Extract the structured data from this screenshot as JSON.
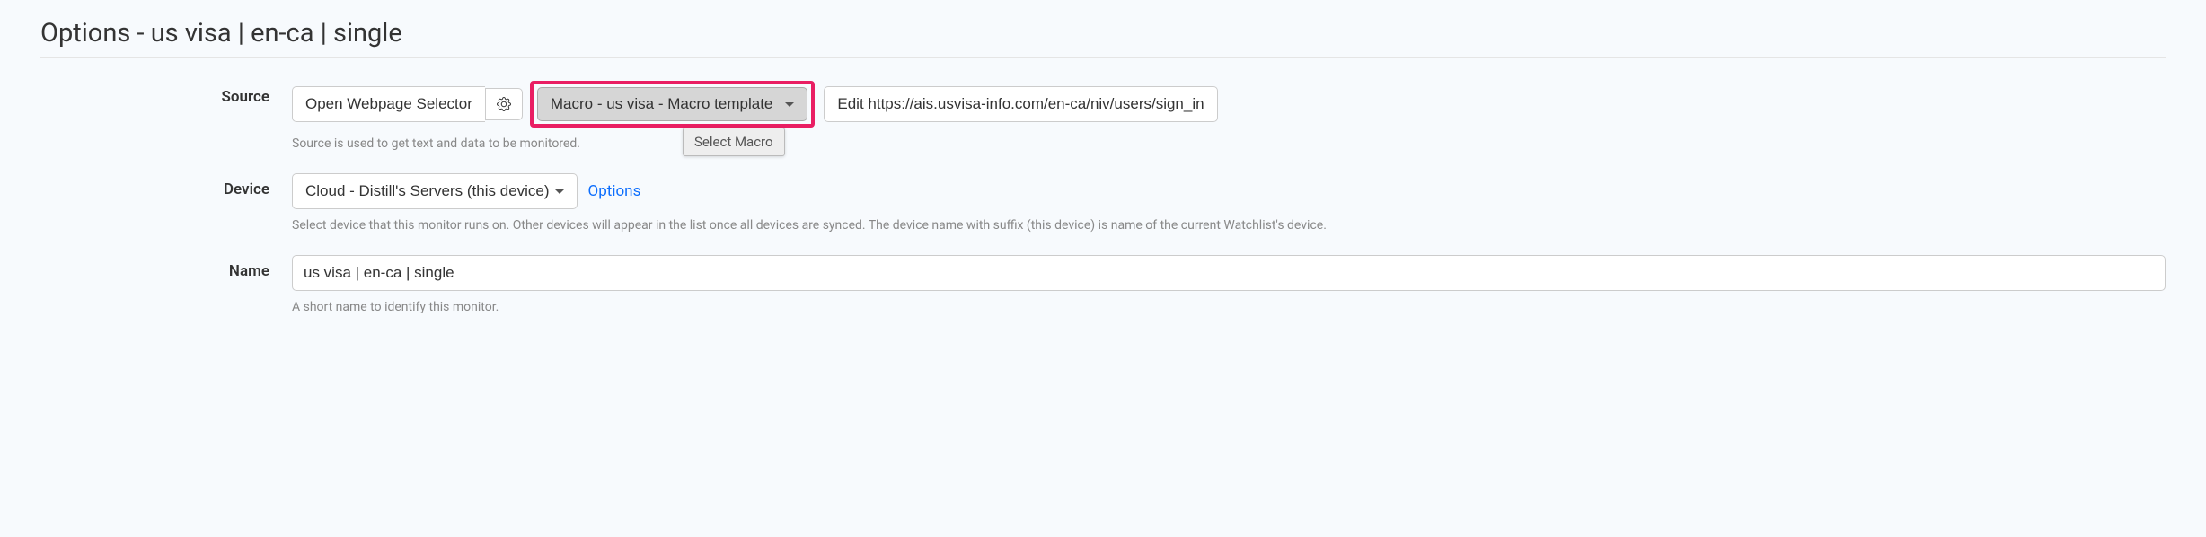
{
  "page_title": "Options - us visa | en-ca | single",
  "source": {
    "label": "Source",
    "webpage_selector_label": "Open Webpage Selector",
    "macro_dropdown_label": "Macro - us visa - Macro template",
    "edit_label": "Edit https://ais.usvisa-info.com/en-ca/niv/users/sign_in",
    "help": "Source is used to get text and data to be monitored.",
    "tooltip": "Select Macro"
  },
  "device": {
    "label": "Device",
    "selected": "Cloud - Distill's Servers (this device)",
    "options_link": "Options",
    "help": "Select device that this monitor runs on. Other devices will appear in the list once all devices are synced. The device name with suffix (this device) is name of the current Watchlist's device."
  },
  "name": {
    "label": "Name",
    "value": "us visa | en-ca | single",
    "help": "A short name to identify this monitor."
  }
}
